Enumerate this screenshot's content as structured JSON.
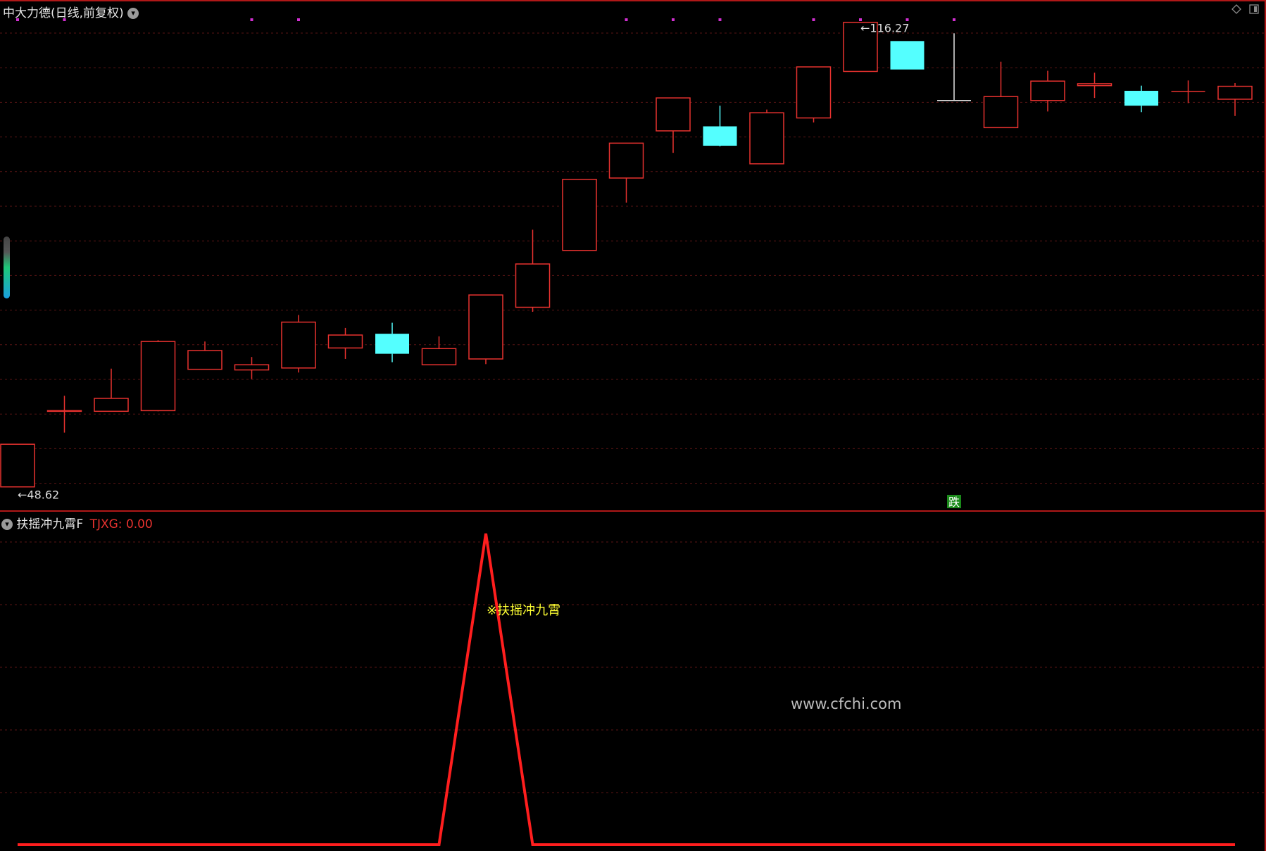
{
  "header": {
    "title": "中大力德(日线,前复权)",
    "menu_icon": "chevron-down-icon",
    "window_icons": [
      "diamond-icon",
      "window-icon"
    ]
  },
  "indicator_panel": {
    "name": "扶摇冲九霄F",
    "value_label": "TJXG: 0.00",
    "signal_label": "※扶摇冲九霄",
    "menu_icon": "chevron-down-icon"
  },
  "annotations": {
    "high_label": "116.27",
    "low_label": "48.62",
    "fall_tag": "跌"
  },
  "watermark": "www.cfchi.com",
  "colors": {
    "background": "#000000",
    "up": "#e8322f",
    "down": "#54ffff",
    "grid": "#5a1414",
    "separator": "#b01818",
    "marker": "#d22fd2",
    "signal_line": "#ff1e1e",
    "signal_text": "#ffff33",
    "fall_tag_bg": "#1a8a1a"
  },
  "chart_data": [
    {
      "type": "candlestick",
      "title": "中大力德(日线,前复权)",
      "series": [
        {
          "open": 47.3,
          "close": 53.9,
          "high": 53.9,
          "low": 47.3
        },
        {
          "open": 59.0,
          "close": 59.1,
          "high": 61.4,
          "low": 55.7
        },
        {
          "open": 59.0,
          "close": 61.0,
          "high": 65.6,
          "low": 59.0
        },
        {
          "open": 59.1,
          "close": 69.8,
          "high": 70.0,
          "low": 59.0
        },
        {
          "open": 65.5,
          "close": 68.4,
          "high": 69.8,
          "low": 65.5
        },
        {
          "open": 65.4,
          "close": 66.2,
          "high": 67.4,
          "low": 64.0
        },
        {
          "open": 65.7,
          "close": 72.8,
          "high": 73.9,
          "low": 65.0
        },
        {
          "open": 68.8,
          "close": 70.8,
          "high": 71.9,
          "low": 67.1
        },
        {
          "open": 71.0,
          "close": 67.9,
          "high": 72.7,
          "low": 66.6
        },
        {
          "open": 66.2,
          "close": 68.7,
          "high": 70.6,
          "low": 66.2
        },
        {
          "open": 67.1,
          "close": 77.0,
          "high": 77.0,
          "low": 66.3
        },
        {
          "open": 75.1,
          "close": 81.8,
          "high": 87.1,
          "low": 74.4
        },
        {
          "open": 83.9,
          "close": 94.9,
          "high": 94.9,
          "low": 83.9
        },
        {
          "open": 95.1,
          "close": 100.5,
          "high": 100.5,
          "low": 91.3
        },
        {
          "open": 102.4,
          "close": 107.5,
          "high": 107.5,
          "low": 99.0
        },
        {
          "open": 103.1,
          "close": 100.1,
          "high": 106.3,
          "low": 100.0
        },
        {
          "open": 97.3,
          "close": 105.2,
          "high": 105.7,
          "low": 97.3
        },
        {
          "open": 104.4,
          "close": 112.3,
          "high": 112.3,
          "low": 103.7
        },
        {
          "open": 111.6,
          "close": 119.2,
          "high": 119.2,
          "low": 111.6
        },
        {
          "open": 116.3,
          "close": 111.9,
          "high": 116.3,
          "low": 111.9
        },
        {
          "open": 107.1,
          "close": 107.1,
          "high": 117.5,
          "low": 107.1
        },
        {
          "open": 102.9,
          "close": 107.7,
          "high": 113.1,
          "low": 102.9
        },
        {
          "open": 107.1,
          "close": 110.1,
          "high": 111.7,
          "low": 105.4
        },
        {
          "open": 109.4,
          "close": 109.7,
          "high": 111.4,
          "low": 107.5
        },
        {
          "open": 108.6,
          "close": 106.3,
          "high": 109.4,
          "low": 105.3
        },
        {
          "open": 108.5,
          "close": 108.5,
          "high": 110.2,
          "low": 106.7
        },
        {
          "open": 107.3,
          "close": 109.3,
          "high": 109.8,
          "low": 104.7
        }
      ],
      "marker_indices": [
        0,
        1,
        5,
        6,
        13,
        14,
        15,
        17,
        18,
        19,
        20
      ],
      "high_index": 18,
      "low_index": 0,
      "fall_tag_index": 20,
      "ylim": [
        44.0,
        122.0
      ]
    },
    {
      "type": "line",
      "title": "扶摇冲九霄F",
      "series": [
        {
          "name": "TJXG",
          "values": [
            0,
            0,
            0,
            0,
            0,
            0,
            0,
            0,
            0,
            0,
            1,
            0,
            0,
            0,
            0,
            0,
            0,
            0,
            0,
            0,
            0,
            0,
            0,
            0,
            0,
            0,
            0
          ]
        }
      ],
      "ylim": [
        0,
        1
      ]
    }
  ]
}
